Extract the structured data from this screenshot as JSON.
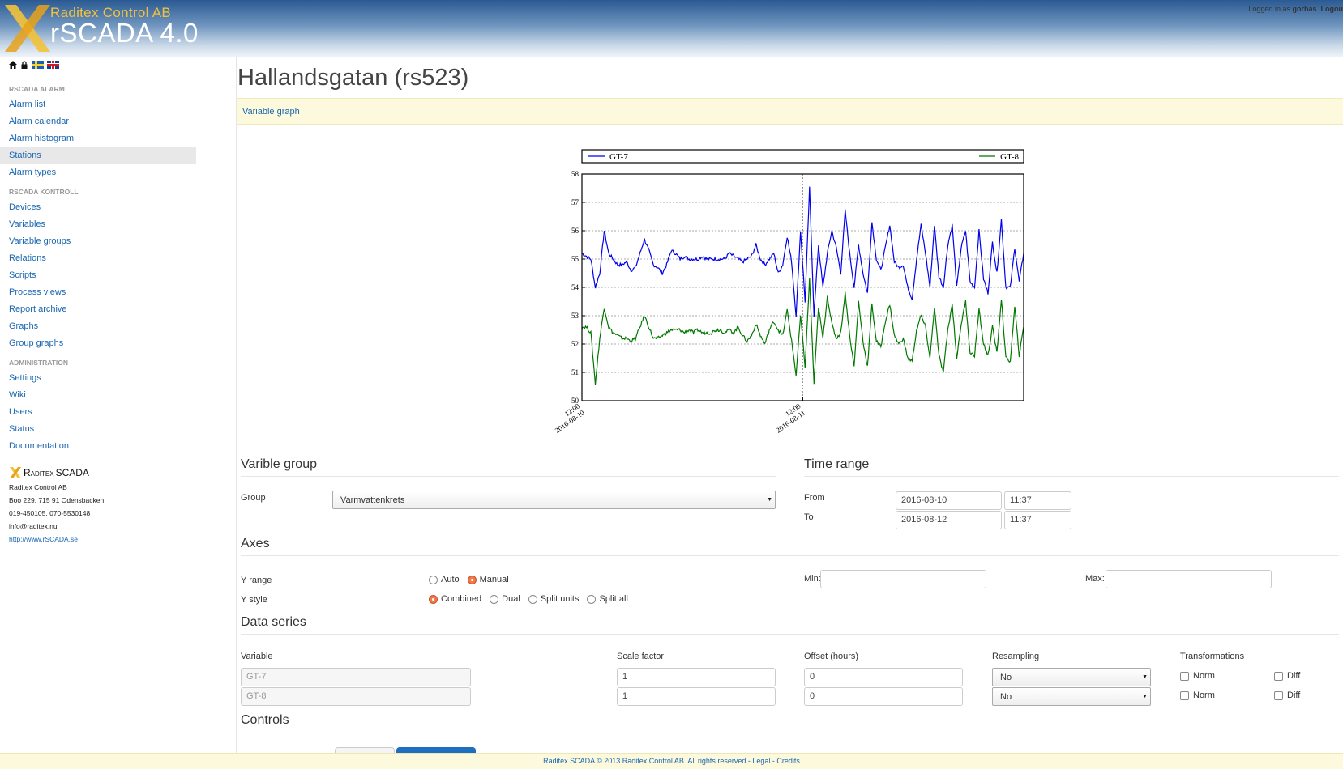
{
  "header": {
    "company": "Raditex Control AB",
    "product": "rSCADA 4.0",
    "logged_in_prefix": "Logged in as",
    "username": "gorhas",
    "logout": "Logou",
    "accent": "#f2c23a"
  },
  "toolbar_icons": [
    "home-icon",
    "lock-icon",
    "flag-se-icon",
    "flag-gb-icon"
  ],
  "sidebar": {
    "alarm_header": "RSCADA ALARM",
    "alarm_items": [
      {
        "label": "Alarm list"
      },
      {
        "label": "Alarm calendar"
      },
      {
        "label": "Alarm histogram"
      },
      {
        "label": "Stations",
        "active": true
      },
      {
        "label": "Alarm types"
      }
    ],
    "kontroll_header": "RSCADA KONTROLL",
    "kontroll_items": [
      {
        "label": "Devices"
      },
      {
        "label": "Variables"
      },
      {
        "label": "Variable groups"
      },
      {
        "label": "Relations"
      },
      {
        "label": "Scripts"
      },
      {
        "label": "Process views"
      },
      {
        "label": "Report archive"
      },
      {
        "label": "Graphs"
      },
      {
        "label": "Group graphs"
      }
    ],
    "admin_header": "ADMINISTRATION",
    "admin_items": [
      {
        "label": "Settings"
      },
      {
        "label": "Wiki"
      },
      {
        "label": "Users"
      },
      {
        "label": "Status"
      },
      {
        "label": "Documentation"
      }
    ],
    "footer": {
      "logo_text_a": "Raditex",
      "logo_text_b": "SCADA",
      "company": "Raditex Control AB",
      "address": "Boo 229, 715 91 Odensbacken",
      "phone": "019-450105, 070-5530148",
      "email": "info@raditex.nu",
      "website": "http://www.rSCADA.se"
    }
  },
  "page": {
    "title": "Hallandsgatan (rs523)",
    "subnav_link": "Variable graph"
  },
  "chart_data": {
    "type": "line",
    "ylim": [
      50,
      58
    ],
    "yticks": [
      "50",
      "51",
      "52",
      "53",
      "54",
      "55",
      "56",
      "57",
      "58"
    ],
    "xticks": [
      {
        "line1": "12:00",
        "line2": "2016-08-10"
      },
      {
        "line1": "12:00",
        "line2": "2016-08-11"
      }
    ],
    "grid": true,
    "legend_position": "top",
    "series": [
      {
        "name": "GT-7",
        "color": "#0000ee",
        "values": [
          55.2,
          55.1,
          55.0,
          54.0,
          54.5,
          56.0,
          55.2,
          55.0,
          54.8,
          54.8,
          54.9,
          54.6,
          54.7,
          55.2,
          55.7,
          55.3,
          54.8,
          54.7,
          54.5,
          54.8,
          55.3,
          55.2,
          55.0,
          55.1,
          55.0,
          55.0,
          55.0,
          55.1,
          55.0,
          55.0,
          55.0,
          55.0,
          55.0,
          55.2,
          55.1,
          55.0,
          54.9,
          55.0,
          55.1,
          55.5,
          55.0,
          54.8,
          55.0,
          55.2,
          54.5,
          54.8,
          55.8,
          54.9,
          53.0,
          56.0,
          53.5,
          57.5,
          53.0,
          55.5,
          54.0,
          55.2,
          56.0,
          55.4,
          54.5,
          56.7,
          55.2,
          54.0,
          55.5,
          54.5,
          53.8,
          56.3,
          55.0,
          54.6,
          55.4,
          56.2,
          54.9,
          54.7,
          54.8,
          54.0,
          53.6,
          55.0,
          56.2,
          55.2,
          54.0,
          56.2,
          54.4,
          54.0,
          55.5,
          56.2,
          54.0,
          55.4,
          56.0,
          54.2,
          54.0,
          56.0,
          54.3,
          53.8,
          55.6,
          54.5,
          56.4,
          54.0,
          54.0,
          55.4,
          54.2,
          55.2
        ]
      },
      {
        "name": "GT-8",
        "color": "#007700",
        "values": [
          52.6,
          52.6,
          52.4,
          50.6,
          52.2,
          53.3,
          52.6,
          52.4,
          52.3,
          52.2,
          52.2,
          52.1,
          52.2,
          52.6,
          53.0,
          52.6,
          52.2,
          52.2,
          52.3,
          52.4,
          52.5,
          52.5,
          52.5,
          52.4,
          52.5,
          52.4,
          52.5,
          52.4,
          52.4,
          52.4,
          52.5,
          52.5,
          52.4,
          52.5,
          52.4,
          52.6,
          52.3,
          52.1,
          52.3,
          52.7,
          52.3,
          52.0,
          52.5,
          52.8,
          52.5,
          52.3,
          53.2,
          52.1,
          50.9,
          53.0,
          51.2,
          54.3,
          50.6,
          53.3,
          52.2,
          53.7,
          52.7,
          52.2,
          52.4,
          53.8,
          52.3,
          51.2,
          53.5,
          52.1,
          51.2,
          53.4,
          52.1,
          51.9,
          52.8,
          53.4,
          52.3,
          52.0,
          52.2,
          51.5,
          51.4,
          52.5,
          53.0,
          52.6,
          51.5,
          53.3,
          51.6,
          51.0,
          52.5,
          53.4,
          51.5,
          52.7,
          53.5,
          51.7,
          51.6,
          53.2,
          52.0,
          51.6,
          52.6,
          51.7,
          53.6,
          51.5,
          51.4,
          53.3,
          51.6,
          52.6
        ]
      }
    ]
  },
  "variable_group": {
    "title": "Varible group",
    "group_label": "Group",
    "group_value": "Varmvattenkrets"
  },
  "time_range": {
    "title": "Time range",
    "from_label": "From",
    "to_label": "To",
    "from_date": "2016-08-10",
    "from_time": "11:37",
    "to_date": "2016-08-12",
    "to_time": "11:37"
  },
  "axes": {
    "title": "Axes",
    "yrange_label": "Y range",
    "yrange_options": [
      {
        "label": "Auto",
        "checked": false
      },
      {
        "label": "Manual",
        "checked": true
      }
    ],
    "ystyle_label": "Y style",
    "ystyle_options": [
      {
        "label": "Combined",
        "checked": true
      },
      {
        "label": "Dual",
        "checked": false
      },
      {
        "label": "Split units",
        "checked": false
      },
      {
        "label": "Split all",
        "checked": false
      }
    ],
    "min_label": "Min:",
    "max_label": "Max:",
    "min_value": "",
    "max_value": ""
  },
  "data_series": {
    "title": "Data series",
    "headers": [
      "Variable",
      "Scale factor",
      "Offset (hours)",
      "Resampling",
      "Transformations"
    ],
    "rows": [
      {
        "variable": "GT-7",
        "scale": "1",
        "offset": "0",
        "resampling": "No",
        "norm_label": "Norm",
        "diff_label": "Diff"
      },
      {
        "variable": "GT-8",
        "scale": "1",
        "offset": "0",
        "resampling": "No",
        "norm_label": "Norm",
        "diff_label": "Diff"
      }
    ]
  },
  "controls": {
    "title": "Controls"
  },
  "footer": {
    "text": "Raditex SCADA © 2013 Raditex Control AB. All rights reserved - Legal - Credits"
  }
}
